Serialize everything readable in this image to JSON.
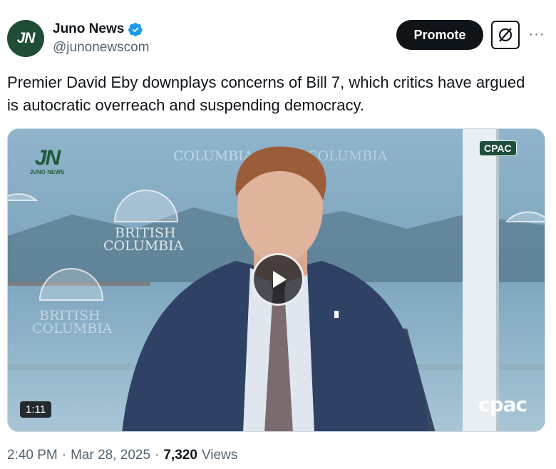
{
  "author": {
    "avatar_text": "JN",
    "display_name": "Juno News",
    "handle": "@junonewscom",
    "verified": true
  },
  "actions": {
    "promote_label": "Promote",
    "grok_icon": "grok-icon",
    "more_icon": "more-icon",
    "more_label": "···"
  },
  "tweet": {
    "text": "Premier David Eby downplays concerns of Bill 7, which critics have argued is autocratic overreach and suspending democracy."
  },
  "media": {
    "type": "video",
    "channel_badge": "CPAC",
    "channel_logo": "cpac",
    "watermark_mark": "JN",
    "watermark_text": "JUNO NEWS",
    "duration": "1:11",
    "backdrop_text_1": "BRITISH",
    "backdrop_text_2": "COLUMBIA"
  },
  "meta": {
    "time": "2:40 PM",
    "sep1": "·",
    "date": "Mar 28, 2025",
    "sep2": "·",
    "views_count": "7,320",
    "views_label": "Views"
  },
  "colors": {
    "accent": "#1d9bf0",
    "text_primary": "#0f1419",
    "text_secondary": "#536471",
    "brand_green": "#1f4d35"
  }
}
